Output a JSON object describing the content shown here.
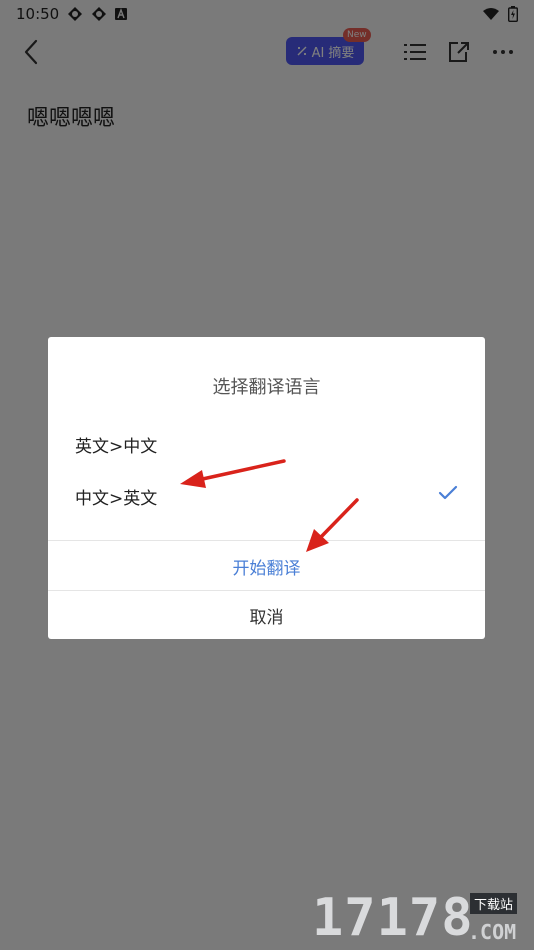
{
  "status": {
    "time": "10:50",
    "icons": [
      "sync-icon",
      "sync-icon",
      "a-notification-icon"
    ],
    "right_icons": [
      "wifi-icon",
      "battery-icon"
    ]
  },
  "topbar": {
    "ai_label": "AI 摘要",
    "new_badge": "New",
    "icons": [
      "back-icon",
      "list-icon",
      "share-icon",
      "more-icon"
    ]
  },
  "note": {
    "title": "嗯嗯嗯嗯"
  },
  "dialog": {
    "title": "选择翻译语言",
    "options": [
      {
        "label": "英文>中文",
        "selected": false
      },
      {
        "label": "中文>英文",
        "selected": true
      }
    ],
    "start_label": "开始翻译",
    "cancel_label": "取消"
  },
  "watermark": {
    "digits": "17178",
    "tag": "下载站",
    "domain": ".COM"
  },
  "colors": {
    "accent": "#4a7fd6",
    "ai_button": "#4f57f0",
    "new_badge": "#e85d53",
    "overlay": "rgba(0,0,0,0.5)"
  }
}
